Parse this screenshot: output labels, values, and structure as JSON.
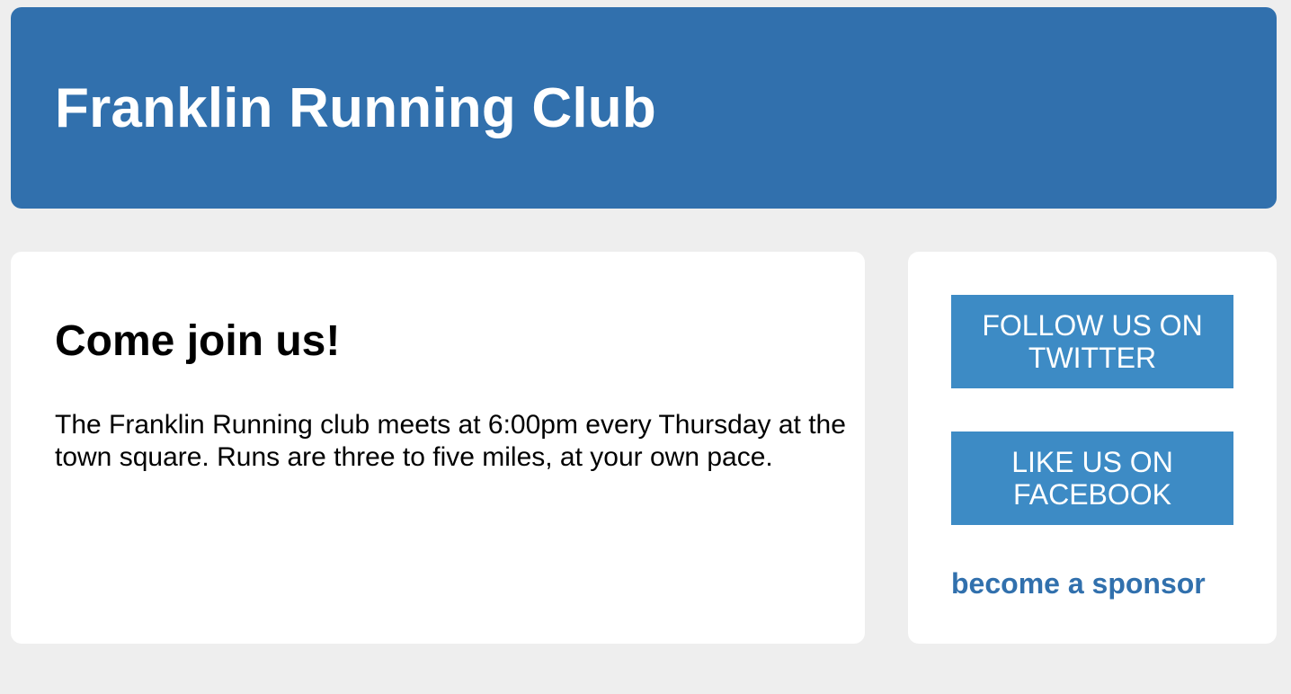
{
  "header": {
    "title": "Franklin Running Club"
  },
  "main": {
    "heading": "Come join us!",
    "body": "The Franklin Running club meets at 6:00pm every Thursday at the town square. Runs are three to five miles, at your own pace."
  },
  "sidebar": {
    "twitter_label": "FOLLOW US ON TWITTER",
    "facebook_label": "LIKE US ON FACEBOOK",
    "sponsor_label": "become a sponsor"
  },
  "colors": {
    "page_background": "#eeeeee",
    "header_background": "#3170ad",
    "card_background": "#ffffff",
    "button_background": "#3d8bc5",
    "link_color": "#3170ad"
  }
}
